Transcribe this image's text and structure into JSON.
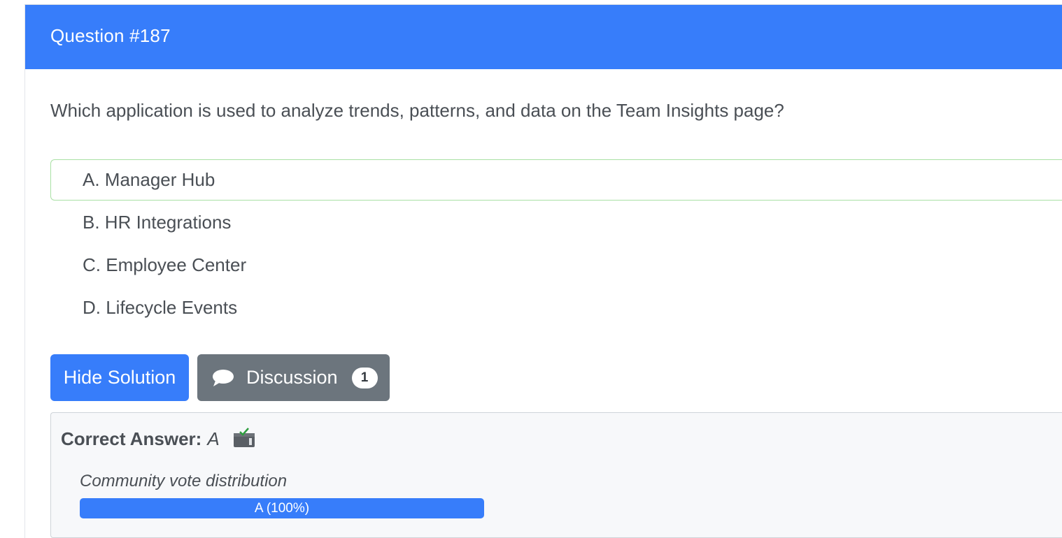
{
  "header": {
    "title": "Question #187"
  },
  "question": {
    "text": "Which application is used to analyze trends, patterns, and data on the Team Insights page?"
  },
  "choices": [
    {
      "label": "A. Manager Hub",
      "correct": true
    },
    {
      "label": "B. HR Integrations",
      "correct": false
    },
    {
      "label": "C. Employee Center",
      "correct": false
    },
    {
      "label": "D. Lifecycle Events",
      "correct": false
    }
  ],
  "buttons": {
    "hide_solution": "Hide Solution",
    "discussion": "Discussion",
    "discussion_count": "1"
  },
  "answer": {
    "label": "Correct Answer:",
    "value": "A",
    "vote_title": "Community vote distribution",
    "votes": [
      {
        "label": "A (100%)",
        "percent": 100
      }
    ]
  },
  "colors": {
    "primary": "#377dfa",
    "secondary": "#6c757d",
    "correct_border": "#a9e0a4",
    "panel_bg": "#f7f8fa"
  },
  "icons": {
    "discussion": "chat-bubble-icon",
    "vote": "ballot-box-icon"
  }
}
